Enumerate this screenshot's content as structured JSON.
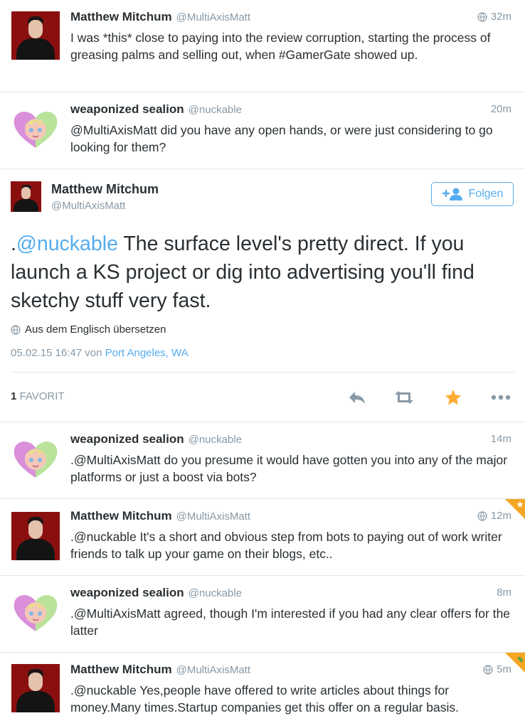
{
  "tweets_before": [
    {
      "name": "Matthew Mitchum",
      "handle": "@MultiAxisMatt",
      "time": "32m",
      "text": "I was *this* close to paying into the review corruption, starting the process of greasing palms and selling out, when #GamerGate showed up."
    },
    {
      "name": "weaponized sealion",
      "handle": "@nuckable",
      "time": "20m",
      "text": "@MultiAxisMatt did you have any open hands, or were just considering to go looking for them?"
    }
  ],
  "main_tweet": {
    "name": "Matthew Mitchum",
    "handle": "@MultiAxisMatt",
    "follow_label": "Folgen",
    "text_prefix": ".",
    "mention": "@nuckable",
    "text_body": " The surface level's pretty direct. If you launch a KS project or dig into advertising you'll find sketchy stuff very fast.",
    "translate_label": "Aus dem Englisch übersetzen",
    "date": "05.02.15 16:47",
    "via_label": "von",
    "location": "Port Angeles, WA",
    "favorites_count": "1",
    "favorites_label": "FAVORIT"
  },
  "replies": [
    {
      "name": "weaponized sealion",
      "handle": "@nuckable",
      "time": "14m",
      "text": ".@MultiAxisMatt do you presume it would have gotten you into any of the major platforms or just a boost via bots?"
    },
    {
      "name": "Matthew Mitchum",
      "handle": "@MultiAxisMatt",
      "time": "12m",
      "text": ".@nuckable It's a short and obvious step from bots to paying out of work writer friends to talk up your game on their blogs, etc.."
    },
    {
      "name": "weaponized sealion",
      "handle": "@nuckable",
      "time": "8m",
      "text": ".@MultiAxisMatt agreed, though I'm interested if you had any clear offers for the latter"
    },
    {
      "name": "Matthew Mitchum",
      "handle": "@MultiAxisMatt",
      "time": "5m",
      "text": ".@nuckable Yes,people have offered to write articles about things for money.Many times.Startup companies get this offer on a regular basis."
    }
  ],
  "colors": {
    "link": "#55acee",
    "meta": "#8899a6",
    "text": "#292f33",
    "favorite_star": "#ffac33",
    "separator": "#e1e8ed"
  },
  "icons": {
    "reply": "reply-icon",
    "retweet": "retweet-icon",
    "favorite": "star-icon",
    "more": "more-dots-icon",
    "globe": "globe-icon",
    "follow": "add-user-icon"
  }
}
